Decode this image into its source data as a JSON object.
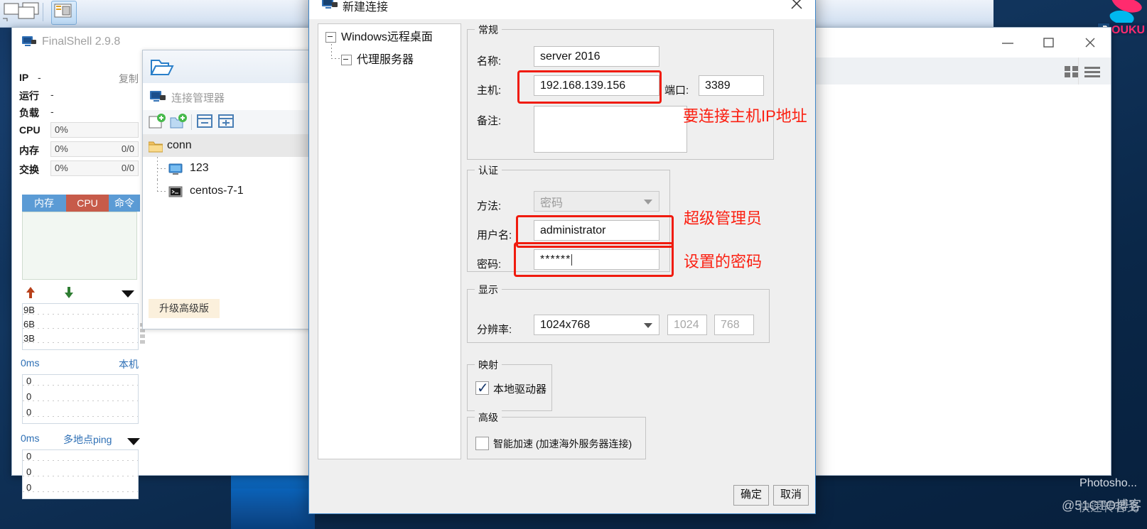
{
  "desktop": {
    "watermark_app": "Photosho...",
    "watermark_site": "@51CTO博客",
    "watermark_site_overlay": "快速转客戈",
    "youku_logo_text": "OUKU"
  },
  "finalshell": {
    "title": "FinalShell 2.9.8",
    "title_icon": "monitor-icon",
    "window_buttons": {
      "minimize": "minimize-icon",
      "maximize": "maximize-icon",
      "close": "close-icon"
    },
    "info": {
      "ip_label": "IP",
      "ip_value": "-",
      "copy_label": "复制",
      "run_label": "运行",
      "run_value": "-",
      "load_label": "负载",
      "load_value": "-",
      "cpu_label": "CPU",
      "cpu_value": "0%",
      "mem_label": "内存",
      "mem_value": "0%",
      "mem_extra": "0/0",
      "swap_label": "交换",
      "swap_value": "0%",
      "swap_extra": "0/0"
    },
    "tabs": [
      {
        "label": "内存",
        "active": false
      },
      {
        "label": "CPU",
        "active": true
      },
      {
        "label": "命令",
        "active": false
      }
    ],
    "net_graph": {
      "up_icon": "arrow-up-icon",
      "down_icon": "arrow-down-icon",
      "menu_icon": "chevron-down-icon",
      "y_ticks": [
        "9B",
        "6B",
        "3B"
      ]
    },
    "ping_local": {
      "value": "0ms",
      "label": "本机",
      "y_ticks": [
        "0",
        "0",
        "0"
      ]
    },
    "ping_multi": {
      "value": "0ms",
      "label": "多地点ping",
      "menu_icon": "chevron-down-icon",
      "y_ticks": [
        "0",
        "0",
        "0"
      ]
    },
    "right_tools": {
      "grid_icon": "grid-view-icon",
      "list_icon": "list-view-icon"
    }
  },
  "conn_manager": {
    "folder_icon": "open-folder-icon",
    "header_icon": "monitor-icon",
    "header_title": "连接管理器",
    "toolbar": [
      {
        "name": "new-connection-button",
        "icon": "new-file-plus-icon"
      },
      {
        "name": "new-folder-button",
        "icon": "new-folder-plus-icon"
      },
      {
        "name": "collapse-all-button",
        "icon": "collapse-icon"
      },
      {
        "name": "expand-all-button",
        "icon": "expand-icon"
      }
    ],
    "tree": [
      {
        "label": "conn",
        "icon": "folder-icon",
        "level": 0,
        "selected": true
      },
      {
        "label": "123",
        "icon": "rdp-monitor-icon",
        "level": 1,
        "selected": false
      },
      {
        "label": "centos-7-1",
        "icon": "terminal-icon",
        "level": 1,
        "selected": false
      }
    ],
    "upgrade_button": "升级高级版"
  },
  "dialog": {
    "title": "新建连接",
    "title_icon": "monitor-icon",
    "close_icon": "close-icon",
    "tree": [
      {
        "label": "Windows远程桌面",
        "level": 0
      },
      {
        "label": "代理服务器",
        "level": 1
      }
    ],
    "general": {
      "legend": "常规",
      "name_label": "名称:",
      "name_value": "server 2016",
      "host_label": "主机:",
      "host_value": "192.168.139.156",
      "port_label": "端口:",
      "port_value": "3389",
      "note_label": "备注:",
      "note_value": ""
    },
    "auth": {
      "legend": "认证",
      "method_label": "方法:",
      "method_value": "密码",
      "username_label": "用户名:",
      "username_value": "administrator",
      "password_label": "密码:",
      "password_value": "******"
    },
    "display": {
      "legend": "显示",
      "resolution_label": "分辨率:",
      "resolution_value": "1024x768",
      "width_value": "1024",
      "height_value": "768"
    },
    "mapping": {
      "legend": "映射",
      "local_drive_label": "本地驱动器",
      "local_drive_checked": true
    },
    "advanced": {
      "legend": "高级",
      "smart_accel_label": "智能加速 (加速海外服务器连接)",
      "smart_accel_checked": false
    },
    "buttons": {
      "ok": "确定",
      "cancel": "取消"
    },
    "annotations": [
      {
        "text": "要连接主机IP地址",
        "name": "annotation-host"
      },
      {
        "text": "超级管理员",
        "name": "annotation-username"
      },
      {
        "text": "设置的密码",
        "name": "annotation-password"
      }
    ],
    "accent_red": "#f01b0e"
  }
}
